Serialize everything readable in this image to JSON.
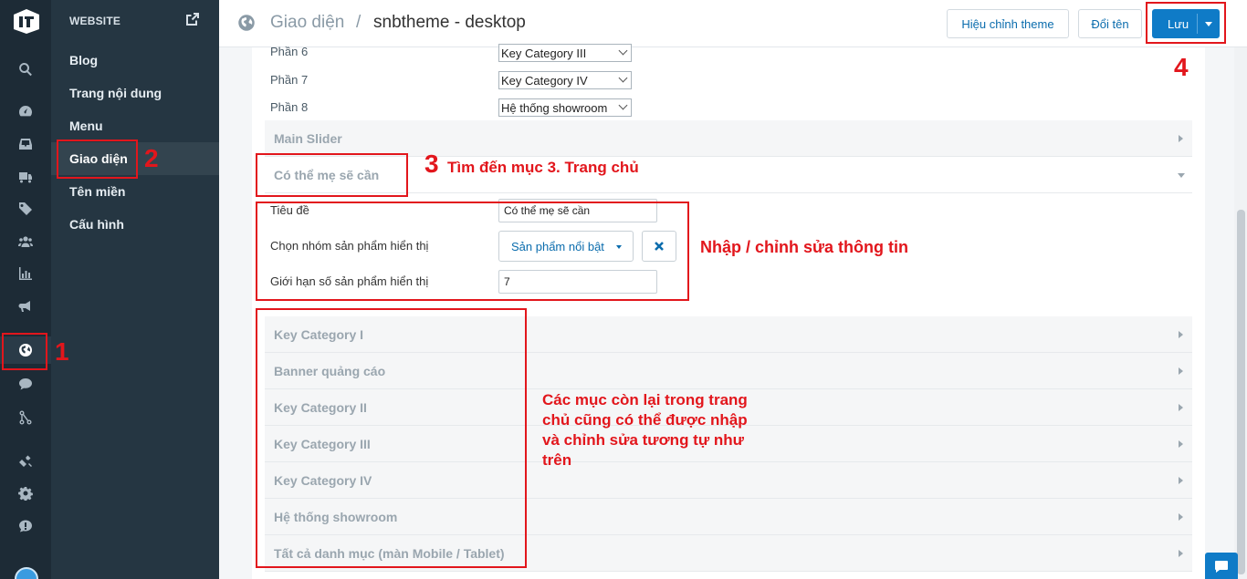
{
  "subnav": {
    "header": "WEBSITE",
    "items": [
      {
        "label": "Blog"
      },
      {
        "label": "Trang nội dung"
      },
      {
        "label": "Menu"
      },
      {
        "label": "Giao diện"
      },
      {
        "label": "Tên miền"
      },
      {
        "label": "Cấu hình"
      }
    ]
  },
  "rail_icons": [
    "logo-icon",
    "search-icon",
    "dashboard-icon",
    "inbox-icon",
    "truck-icon",
    "tag-icon",
    "users-icon",
    "chart-icon",
    "megaphone-icon",
    "globe-icon",
    "chat-bubble-icon",
    "branch-icon",
    "tools-icon",
    "gear-icon",
    "help-icon",
    "avatar"
  ],
  "header": {
    "breadcrumb_1": "Giao diện",
    "breadcrumb_sep": "/",
    "breadcrumb_2": "snbtheme - desktop",
    "edit_theme": "Hiệu chỉnh theme",
    "rename": "Đổi tên",
    "save": "Lưu"
  },
  "parts": [
    {
      "label": "Phần 6",
      "value": "Key Category III"
    },
    {
      "label": "Phần 7",
      "value": "Key Category IV"
    },
    {
      "label": "Phần 8",
      "value": "Hệ thống showroom"
    }
  ],
  "sections_top": {
    "main_slider": "Main Slider",
    "open_section": "Có thể mẹ sẽ cần"
  },
  "form": {
    "title_label": "Tiêu đề",
    "title_value": "Có thể mẹ sẽ cần",
    "group_label": "Chọn nhóm sản phẩm hiển thị",
    "group_value": "Sản phẩm nổi bật",
    "limit_label": "Giới hạn số sản phẩm hiển thị",
    "limit_value": "7"
  },
  "sections": [
    {
      "label": "Key Category I"
    },
    {
      "label": "Banner quảng cáo"
    },
    {
      "label": "Key Category II"
    },
    {
      "label": "Key Category III"
    },
    {
      "label": "Key Category IV"
    },
    {
      "label": "Hệ thống showroom"
    },
    {
      "label": "Tất cả danh mục (màn Mobile / Tablet)"
    }
  ],
  "annotations": {
    "n1": "1",
    "n2": "2",
    "n3": "3",
    "n3_text": "Tìm đến mục 3. Trang chủ",
    "n4": "4",
    "edit_text": "Nhập / chỉnh sửa thông tin",
    "rest_text_1": "Các mục còn lại trong trang",
    "rest_text_2": "chủ cũng có thể được nhập",
    "rest_text_3": "và chỉnh sửa tương tự như",
    "rest_text_4": "trên"
  },
  "colors": {
    "annotation_red": "#e2161c",
    "primary_blue": "#0f7bc7",
    "rail_bg": "#1d2b36",
    "subnav_bg": "#253642"
  }
}
